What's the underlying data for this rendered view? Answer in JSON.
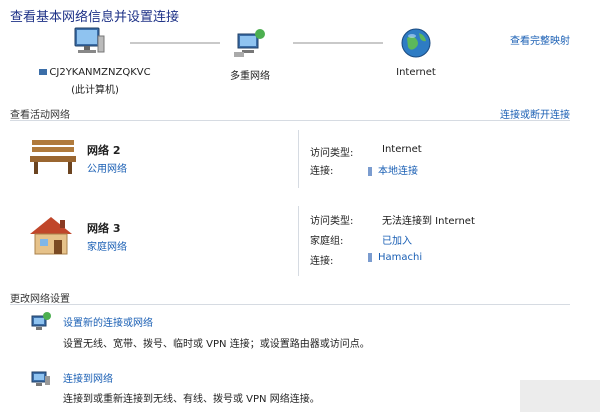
{
  "header": {
    "title": "查看基本网络信息并设置连接",
    "view_full_map": "查看完整映射"
  },
  "map": {
    "computer_name": "CJ2YKANMZNZQKVC",
    "computer_sub": "(此计算机)",
    "middle_label": "多重网络",
    "right_label": "Internet"
  },
  "active": {
    "header": "查看活动网络",
    "connect_disconnect": "连接或断开连接",
    "networks": [
      {
        "name": "网络  2",
        "type": "公用网络",
        "access_label": "访问类型:",
        "access_value": "Internet",
        "conn_label": "连接:",
        "conn_value": "本地连接"
      },
      {
        "name": "网络  3",
        "type": "家庭网络",
        "access_label": "访问类型:",
        "access_value": "无法连接到 Internet",
        "homegroup_label": "家庭组:",
        "homegroup_value": "已加入",
        "conn_label": "连接:",
        "conn_value": "Hamachi"
      }
    ]
  },
  "change": {
    "header": "更改网络设置",
    "items": [
      {
        "title": "设置新的连接或网络",
        "desc": "设置无线、宽带、拨号、临时或 VPN 连接；或设置路由器或访问点。"
      },
      {
        "title": "连接到网络",
        "desc": "连接到或重新连接到无线、有线、拨号或 VPN 网络连接。"
      }
    ]
  },
  "colors": {
    "link": "#1a5fb4",
    "title": "#1e3287"
  }
}
